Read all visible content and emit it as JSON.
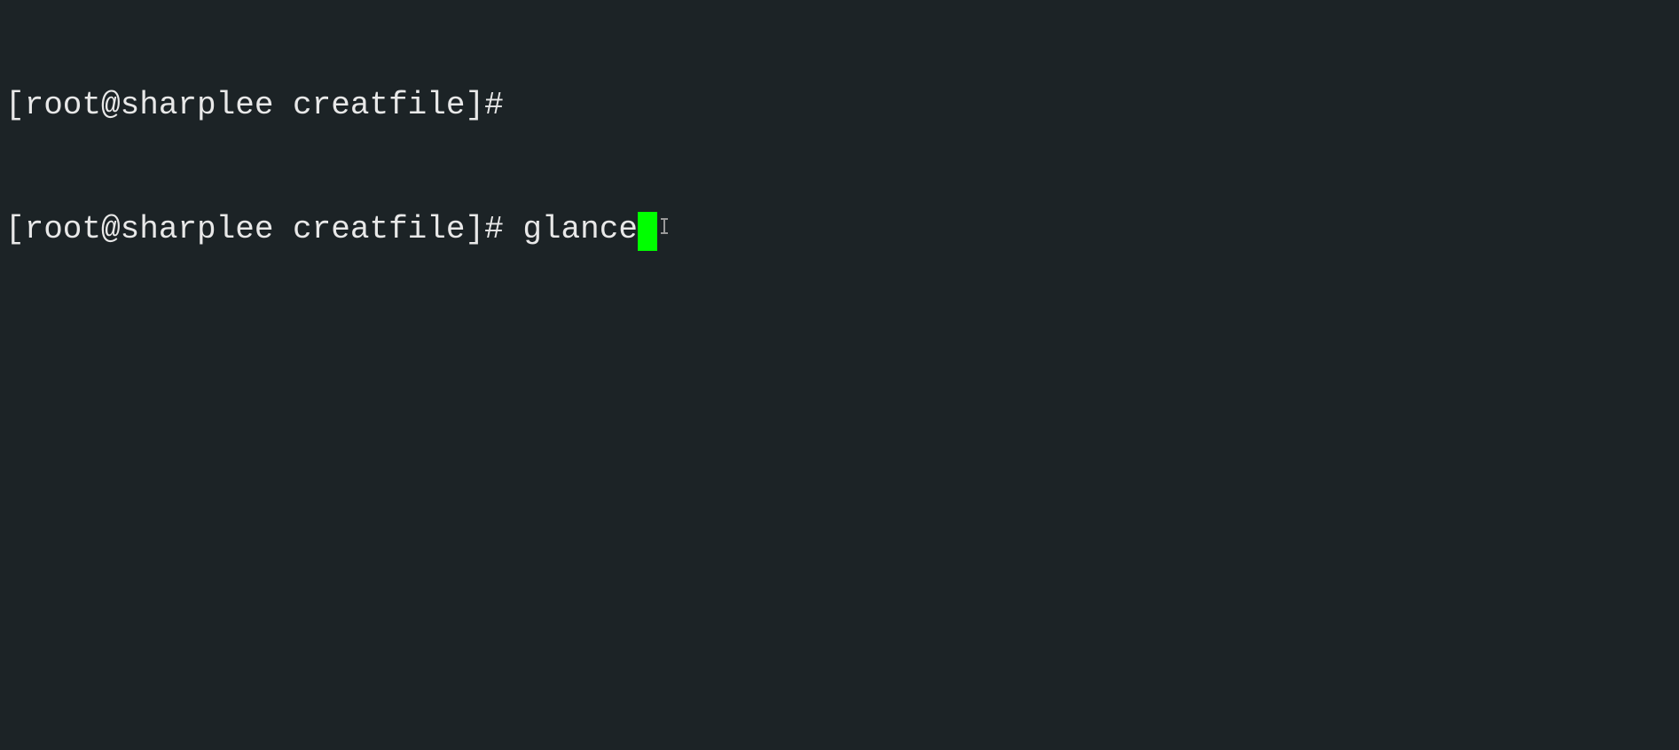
{
  "terminal": {
    "lines": [
      {
        "prompt": "[root@sharplee creatfile]#",
        "command": ""
      },
      {
        "prompt": "[root@sharplee creatfile]#",
        "command": "glance"
      }
    ],
    "cursor_color": "#00ff00",
    "background_color": "#1c2326",
    "text_color": "#e8e8e8"
  }
}
